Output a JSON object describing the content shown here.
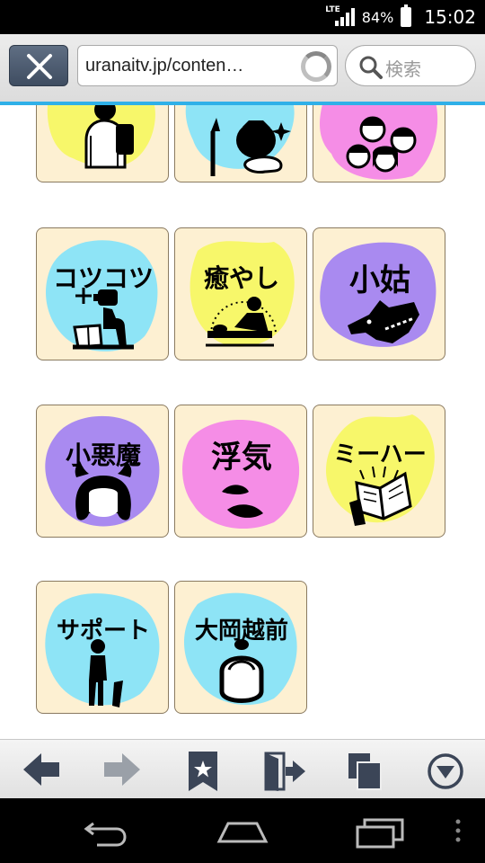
{
  "status_bar": {
    "network": "LTE",
    "battery_percent": "84%",
    "battery_level": 0.84,
    "time": "15:02"
  },
  "browser": {
    "url": "uranaitv.jp/conten…",
    "search_placeholder": "検索",
    "close_icon": "close-icon",
    "reload_icon": "reload-icon",
    "search_icon": "search-icon"
  },
  "content": {
    "tiles": [
      {
        "label": "",
        "blob": "#f7f76a",
        "icon": "person-backpack-icon"
      },
      {
        "label": "",
        "blob": "#8ee4f6",
        "icon": "palette-brush-icon"
      },
      {
        "label": "",
        "blob": "#f58de6",
        "icon": "group-faces-icon"
      },
      {
        "label": "コツコツ",
        "blob": "#8ee4f6",
        "icon": "reading-robot-icon"
      },
      {
        "label": "癒やし",
        "blob": "#f7f76a",
        "icon": "massage-icon"
      },
      {
        "label": "小姑",
        "blob": "#a98af0",
        "icon": "wolf-icon"
      },
      {
        "label": "小悪魔",
        "blob": "#a98af0",
        "icon": "devil-girl-icon"
      },
      {
        "label": "浮気",
        "blob": "#f58de6",
        "icon": "lips-icon"
      },
      {
        "label": "ミーハー",
        "blob": "#f7f76a",
        "icon": "book-icon"
      },
      {
        "label": "サポート",
        "blob": "#8ee4f6",
        "icon": "walking-person-icon"
      },
      {
        "label": "大岡越前",
        "blob": "#8ee4f6",
        "icon": "samurai-head-icon"
      }
    ]
  },
  "bottom_bar": {
    "icons": [
      "back-arrow-icon",
      "forward-arrow-icon",
      "bookmark-star-icon",
      "exit-door-icon",
      "tabs-icon",
      "menu-down-icon"
    ]
  },
  "nav_bar": {
    "icons": [
      "nav-back-icon",
      "nav-home-icon",
      "nav-recents-icon",
      "nav-overflow-icon"
    ]
  },
  "colors": {
    "tile_bg": "#fdf0d2",
    "accent_blue": "#2fb0e8",
    "icon_navy": "#3b4557"
  }
}
